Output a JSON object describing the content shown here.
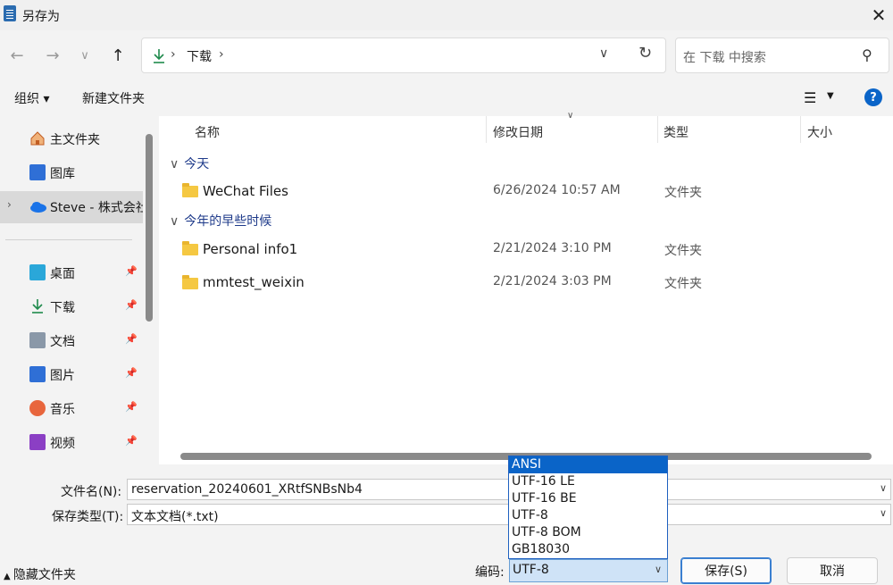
{
  "window": {
    "title": "另存为"
  },
  "address": {
    "segment": "下载",
    "sep": "›"
  },
  "search": {
    "placeholder": "在 下载 中搜索"
  },
  "toolbar": {
    "organize": "组织 ▾",
    "new_folder": "新建文件夹"
  },
  "sidebar": {
    "items": [
      {
        "label": "主文件夹",
        "icon": "home-icon",
        "color": "#e07a3a"
      },
      {
        "label": "图库",
        "icon": "gallery-icon",
        "color": "#2f6fd6"
      },
      {
        "label": "Steve - 株式会社",
        "icon": "cloud-icon",
        "color": "#1a73e8"
      },
      {
        "label": "桌面",
        "icon": "desktop-icon",
        "color": "#2aa7d9"
      },
      {
        "label": "下载",
        "icon": "download-icon",
        "color": "#1f8a4c"
      },
      {
        "label": "文档",
        "icon": "document-icon",
        "color": "#6b7b8c"
      },
      {
        "label": "图片",
        "icon": "picture-icon",
        "color": "#2f6fd6"
      },
      {
        "label": "音乐",
        "icon": "music-icon",
        "color": "#e8663d"
      },
      {
        "label": "视频",
        "icon": "video-icon",
        "color": "#8b3fc4"
      }
    ]
  },
  "columns": {
    "name": "名称",
    "date": "修改日期",
    "type": "类型",
    "size": "大小"
  },
  "groups": [
    {
      "label": "今天",
      "files": [
        {
          "name": "WeChat Files",
          "date": "6/26/2024 10:57 AM",
          "type": "文件夹"
        }
      ]
    },
    {
      "label": "今年的早些时候",
      "files": [
        {
          "name": "Personal info1",
          "date": "2/21/2024 3:10 PM",
          "type": "文件夹"
        },
        {
          "name": "mmtest_weixin",
          "date": "2/21/2024 3:03 PM",
          "type": "文件夹"
        }
      ]
    }
  ],
  "form": {
    "filename_label": "文件名(N):",
    "filename_value": "reservation_20240601_XRtfSNBsNb4",
    "filetype_label": "保存类型(T):",
    "filetype_value": "文本文档(*.txt)"
  },
  "encoding": {
    "label": "编码:",
    "selected": "UTF-8",
    "options": [
      "ANSI",
      "UTF-16 LE",
      "UTF-16 BE",
      "UTF-8",
      "UTF-8 BOM",
      "GB18030"
    ]
  },
  "footer": {
    "hide_folders": "隐藏文件夹",
    "save": "保存(S)",
    "cancel": "取消"
  }
}
